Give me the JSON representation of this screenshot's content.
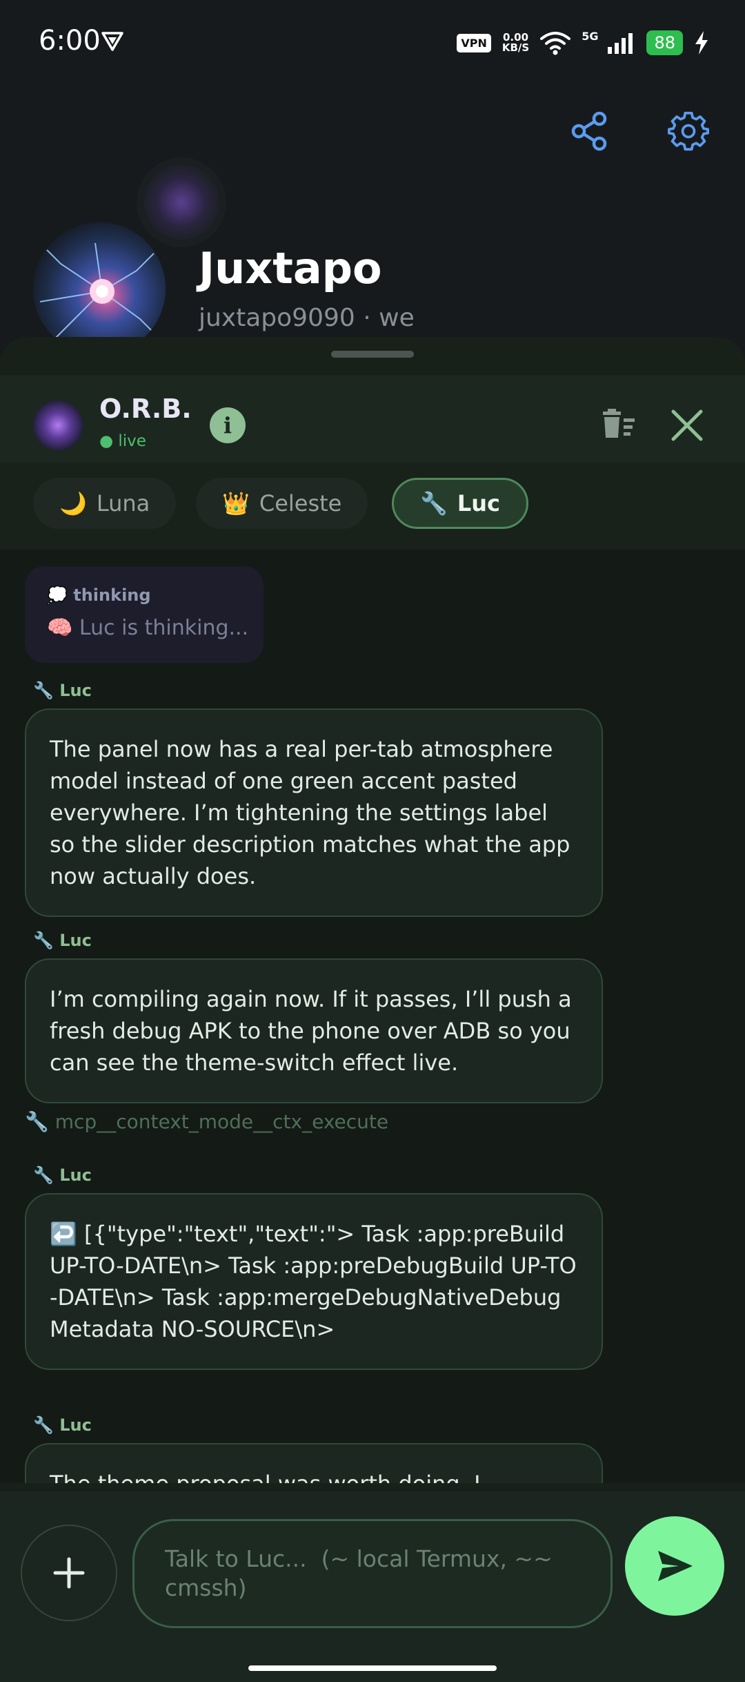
{
  "status_bar": {
    "time": "6:00",
    "vpn": "VPN",
    "net_speed_value": "0.00",
    "net_speed_unit": "KB/S",
    "network_type": "5G",
    "battery": "88"
  },
  "profile": {
    "name": "Juxtapo",
    "subtitle": "juxtapo9090 · we"
  },
  "panel": {
    "title": "O.R.B.",
    "status": "● live"
  },
  "tabs": [
    {
      "icon": "🌙",
      "label": "Luna",
      "active": false
    },
    {
      "icon": "👑",
      "label": "Celeste",
      "active": false
    },
    {
      "icon": "🔧",
      "label": "Luc",
      "active": true
    }
  ],
  "thinking": {
    "header": "💭 thinking",
    "text": "🧠 Luc is thinking..."
  },
  "messages": [
    {
      "sender": "🔧 Luc",
      "text": "The panel now has a real per-tab atmosphere model instead of one green accent pasted everywhere. I’m tightening the settings label so the slider description matches what the app now actually does."
    },
    {
      "sender": "🔧 Luc",
      "text": "I’m compiling again now. If it passes, I’ll push a fresh debug APK to the phone over ADB so you can see the theme-switch effect live."
    },
    {
      "tool": "🔧 mcp__context_mode__ctx_execute"
    },
    {
      "sender": "🔧 Luc",
      "text": "↩️ [{\"type\":\"text\",\"text\":\"> Task :app:preBuild UP-TO-DATE\\n> Task :app:preDebugBuild UP-TO-DATE\\n> Task :app:mergeDebugNativeDebugMetadata NO-SOURCE\\n>"
    },
    {
      "sender": "🔧 Luc",
      "text": "The theme proposal was worth doing. I"
    }
  ],
  "composer": {
    "placeholder": "Talk to Luc...  (~ local Termux, ~~ cmssh)"
  },
  "colors": {
    "accent_green": "#7ef59d",
    "live_green": "#4fbf6f",
    "icon_blue": "#5b9cf0"
  }
}
